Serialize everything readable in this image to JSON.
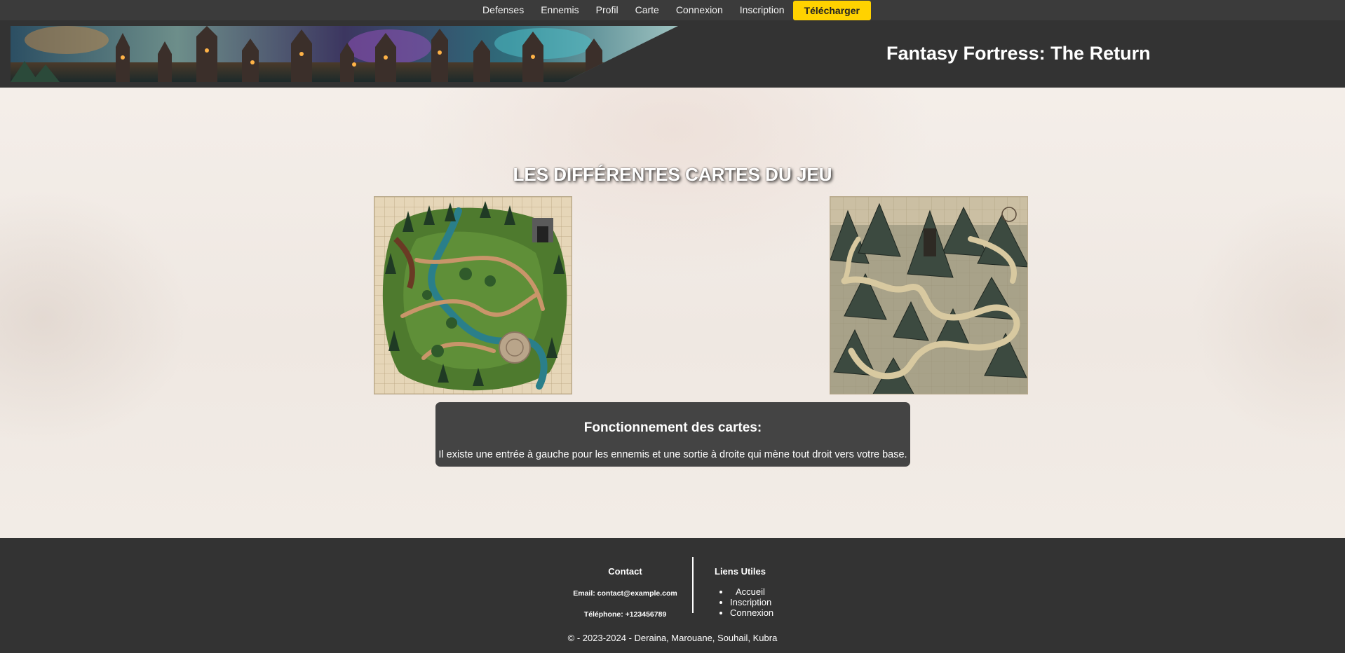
{
  "nav": {
    "items": [
      {
        "label": "Defenses"
      },
      {
        "label": "Ennemis"
      },
      {
        "label": "Profil"
      },
      {
        "label": "Carte"
      },
      {
        "label": "Connexion"
      },
      {
        "label": "Inscription"
      }
    ],
    "download_label": "Télécharger",
    "download_color": "#ffd200"
  },
  "header": {
    "title": "Fantasy Fortress: The Return"
  },
  "main": {
    "section_title": "LES DIFFÉRENTES CARTES DU JEU",
    "info_box": {
      "title": "Fonctionnement des cartes:",
      "text": "Il existe une entrée à gauche pour les ennemis et une sortie à droite qui mène tout droit vers votre base."
    }
  },
  "footer": {
    "contact": {
      "heading": "Contact",
      "email": "Email: contact@example.com",
      "phone": "Téléphone: +123456789"
    },
    "links": {
      "heading": "Liens Utiles",
      "items": [
        "Accueil",
        "Inscription",
        "Connexion"
      ]
    },
    "copyright": "© - 2023-2024 - Deraina, Marouane, Souhail, Kubra"
  }
}
